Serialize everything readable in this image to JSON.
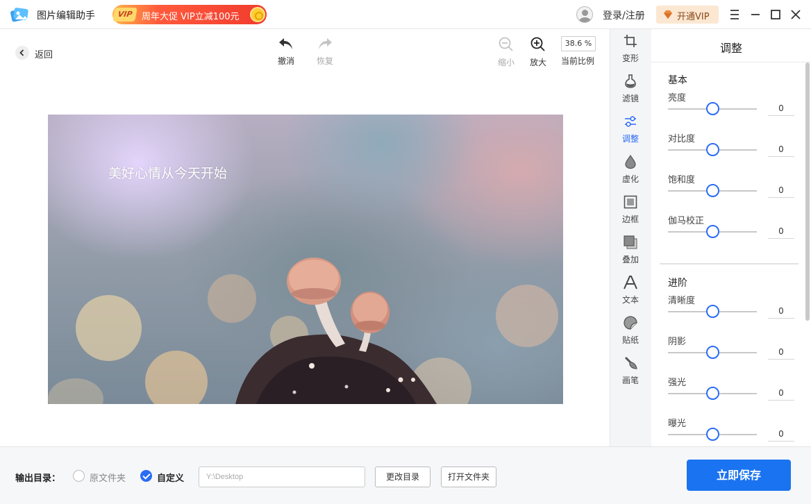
{
  "app": {
    "title": "图片编辑助手",
    "promo_tag": "VIP",
    "promo_text": "周年大促 VIP立减100元",
    "login_text": "登录/注册",
    "vip_button": "开通VIP"
  },
  "toolbar": {
    "back_label": "返回",
    "undo_label": "撤消",
    "redo_label": "恢复",
    "zoom_out_label": "缩小",
    "zoom_in_label": "放大",
    "zoom_value": "38.6 %",
    "zoom_caption": "当前比例"
  },
  "canvas": {
    "caption_text": "美好心情从今天开始"
  },
  "side_tools": [
    {
      "label": "变形",
      "icon": "crop-icon"
    },
    {
      "label": "滤镜",
      "icon": "flask-icon"
    },
    {
      "label": "调整",
      "icon": "sliders-icon",
      "active": true
    },
    {
      "label": "虚化",
      "icon": "drop-icon"
    },
    {
      "label": "边框",
      "icon": "frame-icon"
    },
    {
      "label": "叠加",
      "icon": "overlay-icon"
    },
    {
      "label": "文本",
      "icon": "text-icon"
    },
    {
      "label": "贴纸",
      "icon": "sticker-icon"
    },
    {
      "label": "画笔",
      "icon": "brush-icon"
    }
  ],
  "adjust_panel": {
    "title": "调整",
    "basic_title": "基本",
    "basic": [
      {
        "label": "亮度",
        "value": "0"
      },
      {
        "label": "对比度",
        "value": "0"
      },
      {
        "label": "饱和度",
        "value": "0"
      },
      {
        "label": "伽马校正",
        "value": "0"
      }
    ],
    "advanced_title": "进阶",
    "advanced": [
      {
        "label": "清晰度",
        "value": "0"
      },
      {
        "label": "阴影",
        "value": "0"
      },
      {
        "label": "强光",
        "value": "0"
      },
      {
        "label": "曝光",
        "value": "0"
      }
    ]
  },
  "bottom": {
    "output_label": "输出目录：",
    "option_original": "原文件夹",
    "option_custom": "自定义",
    "path_placeholder": "Y:\\Desktop",
    "change_dir_button": "更改目录",
    "open_folder_button": "打开文件夹",
    "save_button": "立即保存"
  },
  "colors": {
    "accent": "#2a6cf5",
    "save_button": "#1a73f0",
    "promo": "#f13b2e",
    "vip_bg": "#fbe7d2"
  }
}
